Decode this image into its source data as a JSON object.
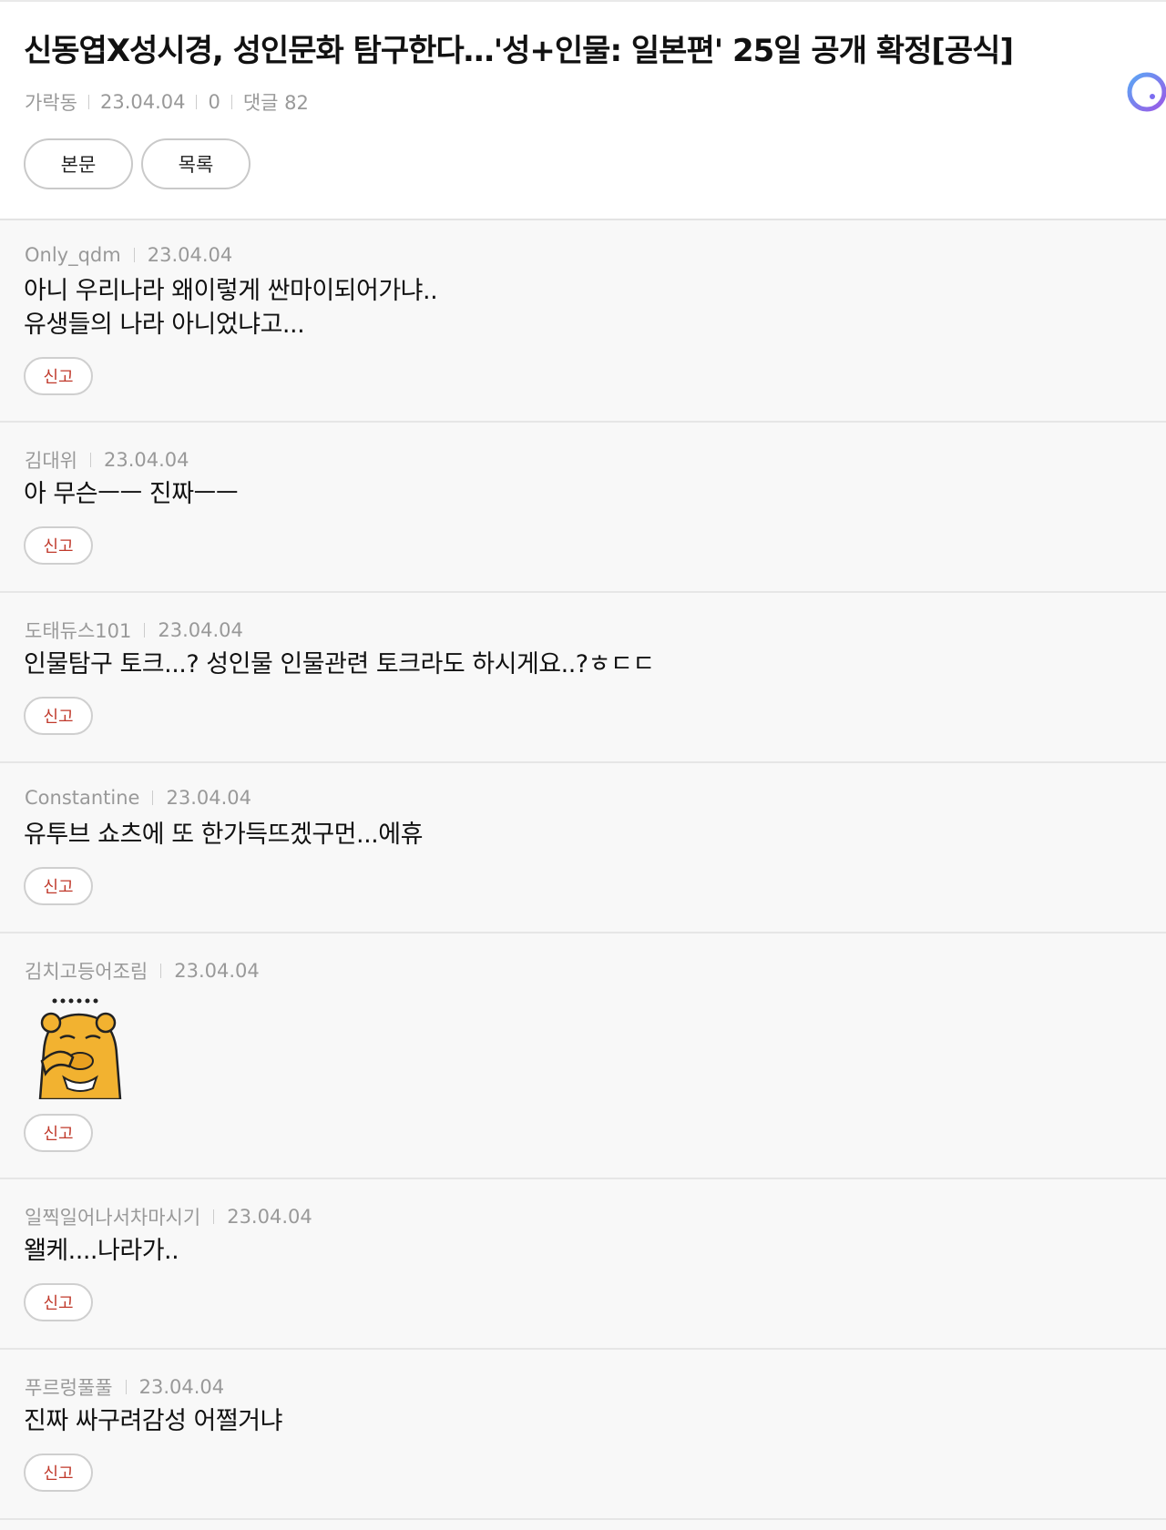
{
  "article": {
    "title": "신동엽X성시경, 성인문화 탐구한다…'성+인물: 일본편' 25일 공개 확정[공식]",
    "author": "가락동",
    "date": "23.04.04",
    "views": "0",
    "comment_count": "댓글 82"
  },
  "buttons": {
    "body": "본문",
    "list": "목록"
  },
  "report_label": "신고",
  "comments": [
    {
      "author": "Only_qdm",
      "date": "23.04.04",
      "text": "아니 우리나라 왜이렇게 싼마이되어가냐..\n유생들의 나라 아니었냐고..."
    },
    {
      "author": "김대위",
      "date": "23.04.04",
      "text": "아 무슨ㅡㅡ 진짜ㅡㅡ"
    },
    {
      "author": "도태듀스101",
      "date": "23.04.04",
      "text": "인물탐구 토크...? 성인물 인물관련 토크라도 하시게요..?ㅎㄷㄷ"
    },
    {
      "author": "Constantine",
      "date": "23.04.04",
      "text": "유투브 쇼츠에 또 한가득뜨겠구먼...에휴"
    },
    {
      "author": "김치고등어조림",
      "date": "23.04.04",
      "text": "",
      "sticker": "embarrassed-bear-sticker"
    },
    {
      "author": "일찍일어나서차마시기",
      "date": "23.04.04",
      "text": "왤케....나라가.."
    },
    {
      "author": "푸르렁풀풀",
      "date": "23.04.04",
      "text": "진짜 싸구려감성 어쩔거냐"
    }
  ],
  "colors": {
    "report_text": "#c0392b",
    "meta_text": "#999999",
    "loader_ring": "#7b6cf0"
  }
}
